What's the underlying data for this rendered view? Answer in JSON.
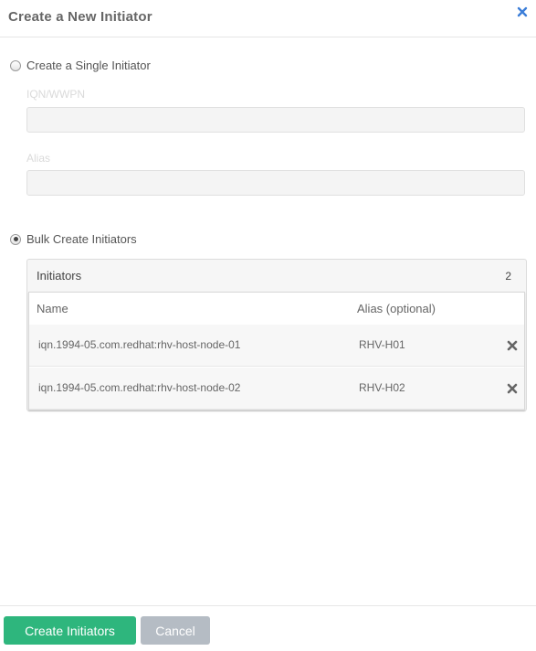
{
  "dialog": {
    "title": "Create a New Initiator",
    "close_icon": "close-icon"
  },
  "single": {
    "radio_label": "Create a Single Initiator",
    "selected": false,
    "iqn_label": "IQN/WWPN",
    "iqn_value": "",
    "alias_label": "Alias",
    "alias_value": ""
  },
  "bulk": {
    "radio_label": "Bulk Create Initiators",
    "selected": true,
    "panel_title": "Initiators",
    "count": "2",
    "columns": {
      "name": "Name",
      "alias": "Alias (optional)"
    },
    "rows": [
      {
        "name": "iqn.1994-05.com.redhat:rhv-host-node-01",
        "alias": "RHV-H01"
      },
      {
        "name": "iqn.1994-05.com.redhat:rhv-host-node-02",
        "alias": "RHV-H02"
      }
    ],
    "remove_icon": "remove-icon"
  },
  "footer": {
    "create_label": "Create Initiators",
    "cancel_label": "Cancel"
  },
  "colors": {
    "primary": "#2eb67d",
    "secondary": "#b5bcc4"
  }
}
